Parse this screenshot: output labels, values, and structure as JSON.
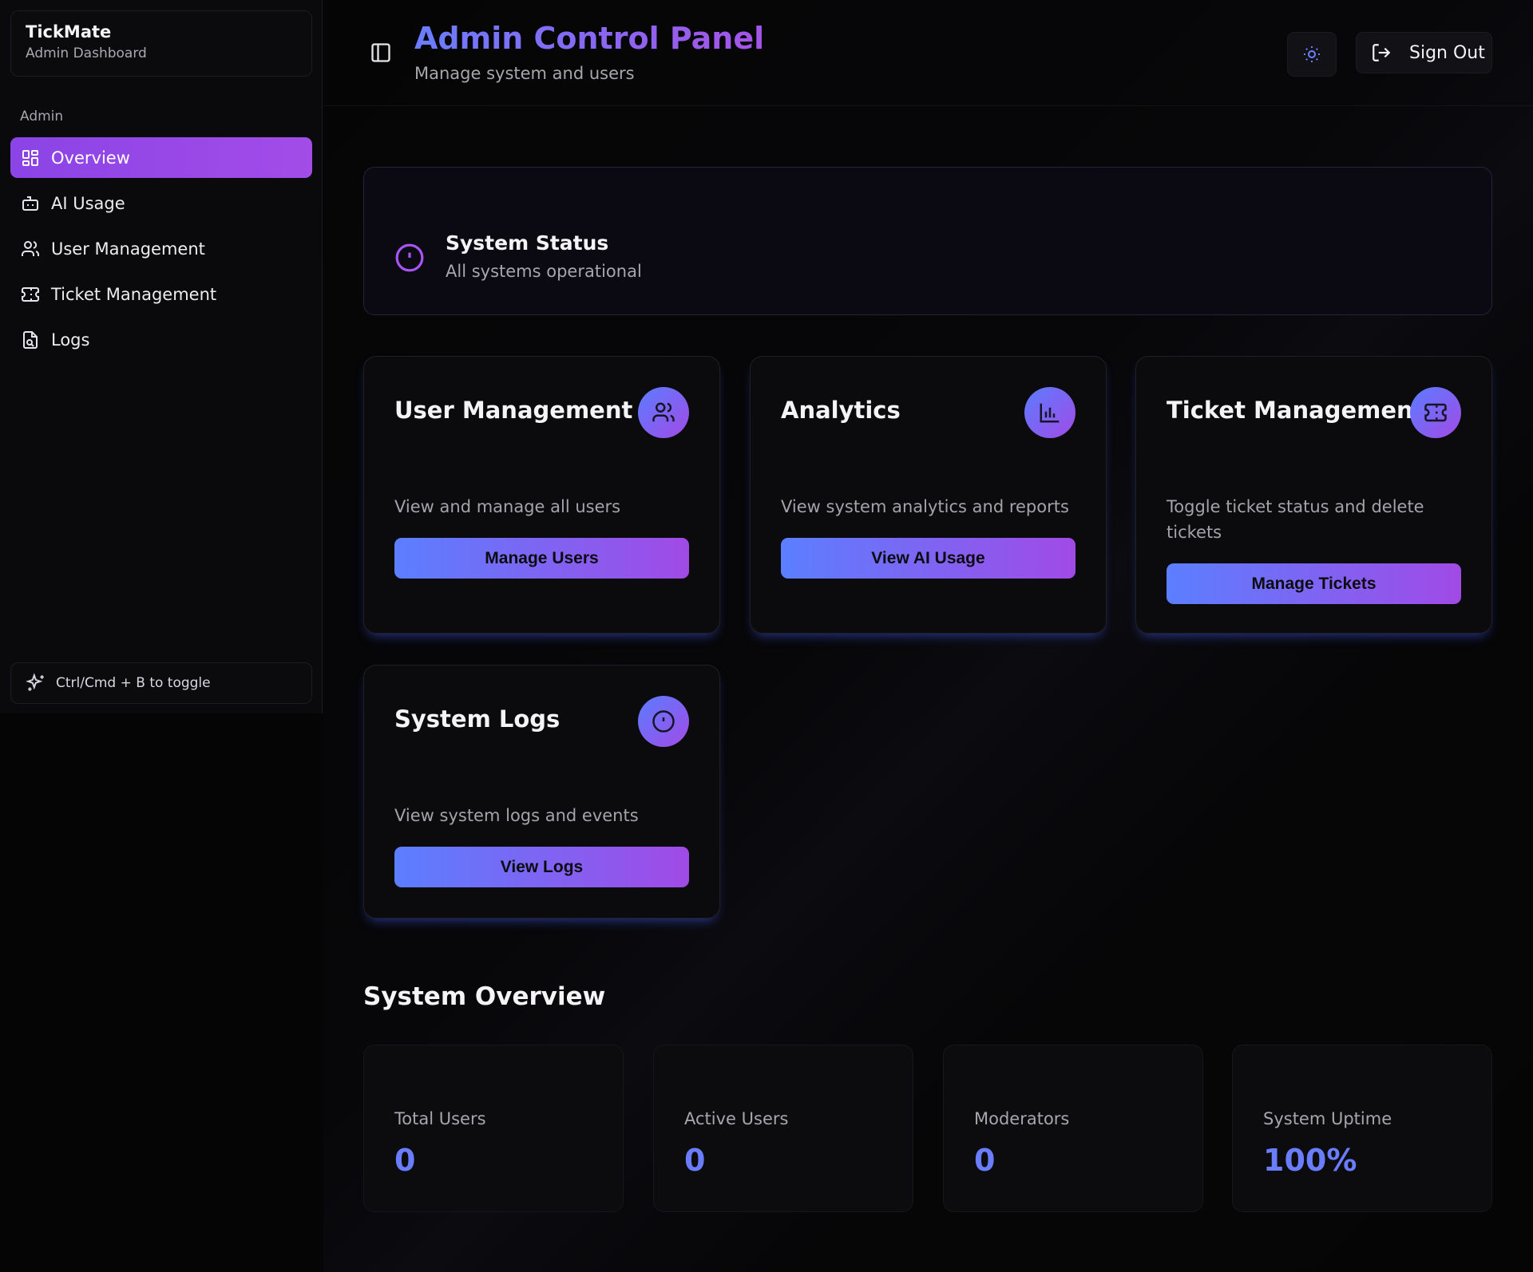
{
  "sidebar": {
    "brand_name": "TickMate",
    "brand_sub": "Admin Dashboard",
    "group_label": "Admin",
    "items": [
      {
        "label": "Overview",
        "icon": "grid-icon",
        "active": true
      },
      {
        "label": "AI Usage",
        "icon": "bot-icon",
        "active": false
      },
      {
        "label": "User Management",
        "icon": "users-icon",
        "active": false
      },
      {
        "label": "Ticket Management",
        "icon": "ticket-icon",
        "active": false
      },
      {
        "label": "Logs",
        "icon": "file-search-icon",
        "active": false
      }
    ],
    "toggle_hint": "Ctrl/Cmd + B to toggle"
  },
  "header": {
    "title": "Admin Control Panel",
    "subtitle": "Manage system and users",
    "signout_label": "Sign Out"
  },
  "status": {
    "title": "System Status",
    "text": "All systems operational"
  },
  "cards": [
    {
      "title": "User Management",
      "icon": "users-icon",
      "description": "View and manage all users",
      "button": "Manage Users"
    },
    {
      "title": "Analytics",
      "icon": "bar-chart-icon",
      "description": "View system analytics and reports",
      "button": "View AI Usage"
    },
    {
      "title": "Ticket Management",
      "icon": "ticket-icon",
      "description": "Toggle ticket status and delete tickets",
      "button": "Manage Tickets"
    },
    {
      "title": "System Logs",
      "icon": "alert-circle-icon",
      "description": "View system logs and events",
      "button": "View Logs"
    }
  ],
  "overview": {
    "title": "System Overview",
    "stats": [
      {
        "label": "Total Users",
        "value": "0"
      },
      {
        "label": "Active Users",
        "value": "0"
      },
      {
        "label": "Moderators",
        "value": "0"
      },
      {
        "label": "System Uptime",
        "value": "100%"
      }
    ]
  },
  "colors": {
    "accent_blue": "#5b7fff",
    "accent_purple": "#a14ae6",
    "stat_value": "#6b7dff",
    "background": "#050506"
  }
}
